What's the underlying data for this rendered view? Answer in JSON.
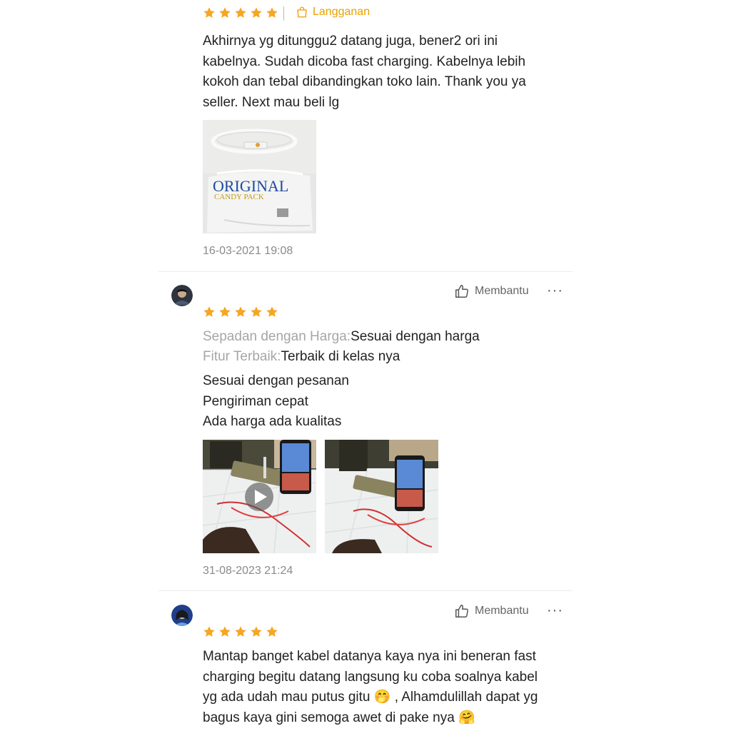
{
  "reviews": [
    {
      "rating": 5,
      "badge": "Langganan",
      "text_lines": [
        "Akhirnya yg ditunggu2 datang juga, bener2 ori ini",
        "kabelnya. Sudah dicoba fast charging. Kabelnya lebih",
        "kokoh dan tebal dibandingkan toko lain. Thank you ya",
        "seller. Next mau beli lg"
      ],
      "photo_text": "ORIGINAL",
      "photo_subtext": "CANDY PACK",
      "date": "16-03-2021 19:08"
    },
    {
      "rating": 5,
      "helpful_label": "Membantu",
      "more_label": "···",
      "attributes": [
        {
          "key": "Sepadan dengan Harga:",
          "value": "Sesuai dengan harga"
        },
        {
          "key": "Fitur Terbaik:",
          "value": "Terbaik di kelas nya"
        }
      ],
      "text_lines": [
        "Sesuai dengan pesanan",
        "Pengiriman cepat",
        "Ada harga ada kualitas"
      ],
      "date": "31-08-2023 21:24"
    },
    {
      "rating": 5,
      "helpful_label": "Membantu",
      "more_label": "···",
      "text_lines": [
        "Mantap banget kabel datanya kaya nya ini beneran fast",
        "charging begitu datang langsung ku coba soalnya kabel",
        "yg ada udah mau putus gitu 🤭 , Alhamdulillah dapat yg",
        "bagus kaya gini semoga awet di pake nya 🤗"
      ]
    }
  ],
  "colors": {
    "star": "#f5a623",
    "badge": "#e8a000",
    "muted": "#8a8a8a",
    "attr_key": "#a6a6a6"
  },
  "icons": {
    "star": "star-icon",
    "bag": "shopping-bag-icon",
    "thumbs_up": "thumbs-up-icon",
    "more": "more-options-icon",
    "play": "play-icon"
  }
}
